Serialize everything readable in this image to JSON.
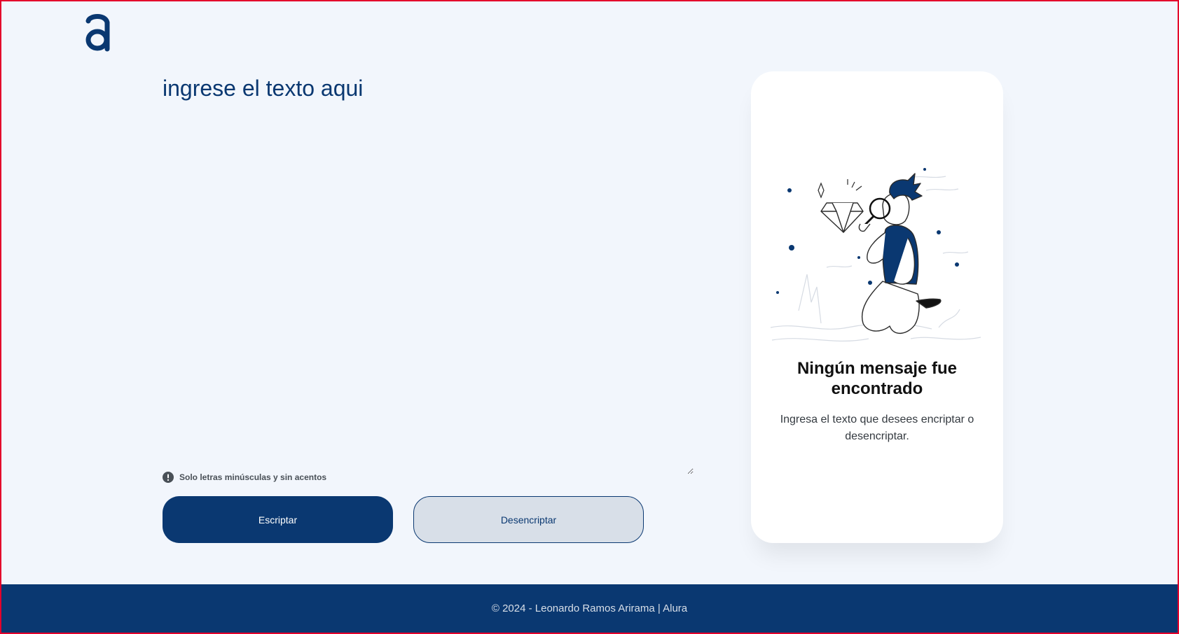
{
  "logo": {
    "icon": "alura-a-logo-icon"
  },
  "input": {
    "placeholder": "ingrese el texto aqui",
    "value": ""
  },
  "hint": {
    "icon": "exclamation-circle-icon",
    "text": "Solo letras minúsculas y sin acentos"
  },
  "buttons": {
    "encrypt_label": "Escriptar",
    "decrypt_label": "Desencriptar"
  },
  "output_card": {
    "illustration": "boy-with-magnifying-glass-diamond-illustration",
    "title": "Ningún mensaje fue encontrado",
    "text": "Ingresa el texto que desees encriptar o desencriptar."
  },
  "footer": {
    "text": "© 2024 - Leonardo Ramos Arirama | Alura"
  },
  "colors": {
    "background": "#f2f6fc",
    "brand": "#0a3871",
    "secondary_button": "#d8dfe8",
    "card": "#ffffff"
  }
}
